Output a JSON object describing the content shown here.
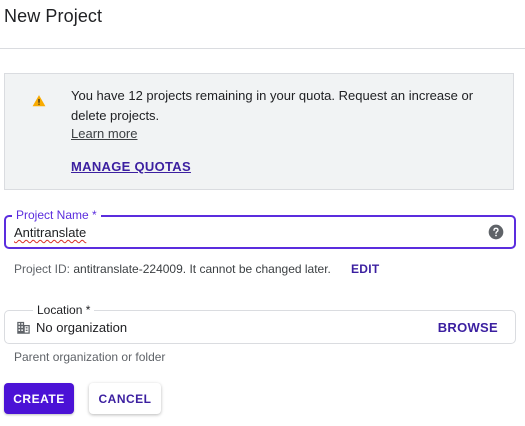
{
  "page": {
    "title": "New Project"
  },
  "notice": {
    "icon": "warning-icon",
    "message": "You have 12 projects remaining in your quota. Request an increase or delete projects.",
    "learn_more": "Learn more",
    "manage_quotas": "MANAGE QUOTAS"
  },
  "project_name": {
    "label": "Project Name *",
    "value": "Antitranslate",
    "help_icon": "help-circle-icon"
  },
  "project_id": {
    "prefix": "Project ID: ",
    "value": "antitranslate-224009",
    "suffix": ". It cannot be changed later.",
    "edit_label": "EDIT"
  },
  "location": {
    "label": "Location *",
    "value": "No organization",
    "icon": "building-icon",
    "browse_label": "BROWSE",
    "hint": "Parent organization or folder"
  },
  "actions": {
    "create_label": "CREATE",
    "cancel_label": "CANCEL"
  },
  "colors": {
    "accent": "#4b12d6",
    "link": "#3b1fa0",
    "warning": "#f9ab00",
    "notice_bg": "#f1f3f4",
    "error_underline": "#d93025"
  }
}
